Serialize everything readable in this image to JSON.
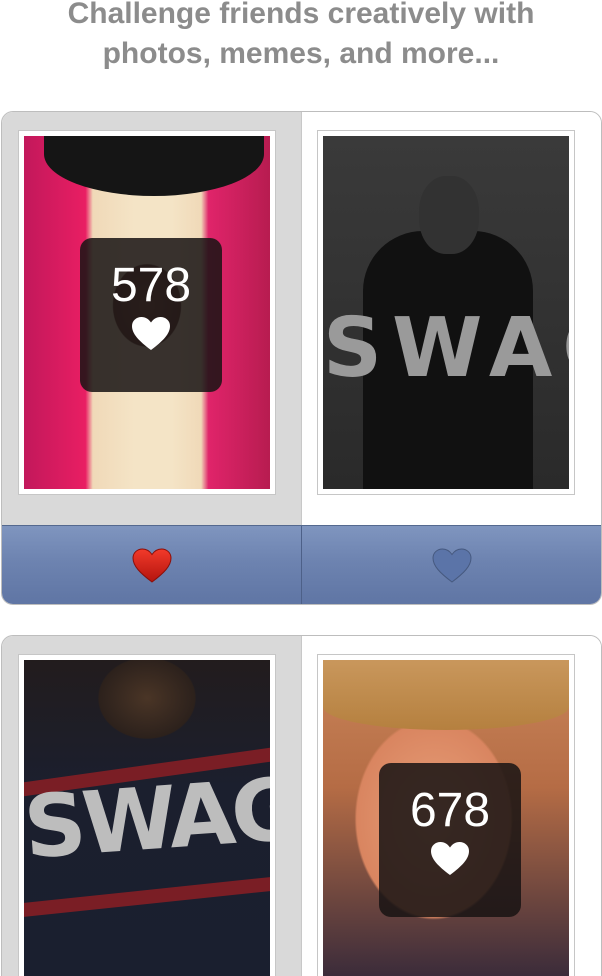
{
  "headline": {
    "line1": "Challenge friends creatively with",
    "line2": "photos, memes, and more..."
  },
  "battles": [
    {
      "left": {
        "photo_text": "",
        "votes": "578",
        "vote_icon": "heart-icon",
        "voted": true
      },
      "right": {
        "photo_text": "SWAG",
        "votes": "",
        "voted": false
      },
      "vote_buttons": {
        "left_icon": "heart-filled-red-icon",
        "right_icon": "heart-outline-icon"
      }
    },
    {
      "left": {
        "photo_text": "SWAG",
        "votes": "",
        "voted": false
      },
      "right": {
        "photo_text": "",
        "votes": "678",
        "vote_icon": "heart-icon",
        "voted": true
      }
    }
  ],
  "colors": {
    "headline": "#8c8c8c",
    "winner_bg": "#d9d9d9",
    "vote_bar": "#6d83b0",
    "heart_active": "#e0251b",
    "heart_inactive": "#5b74a8"
  }
}
